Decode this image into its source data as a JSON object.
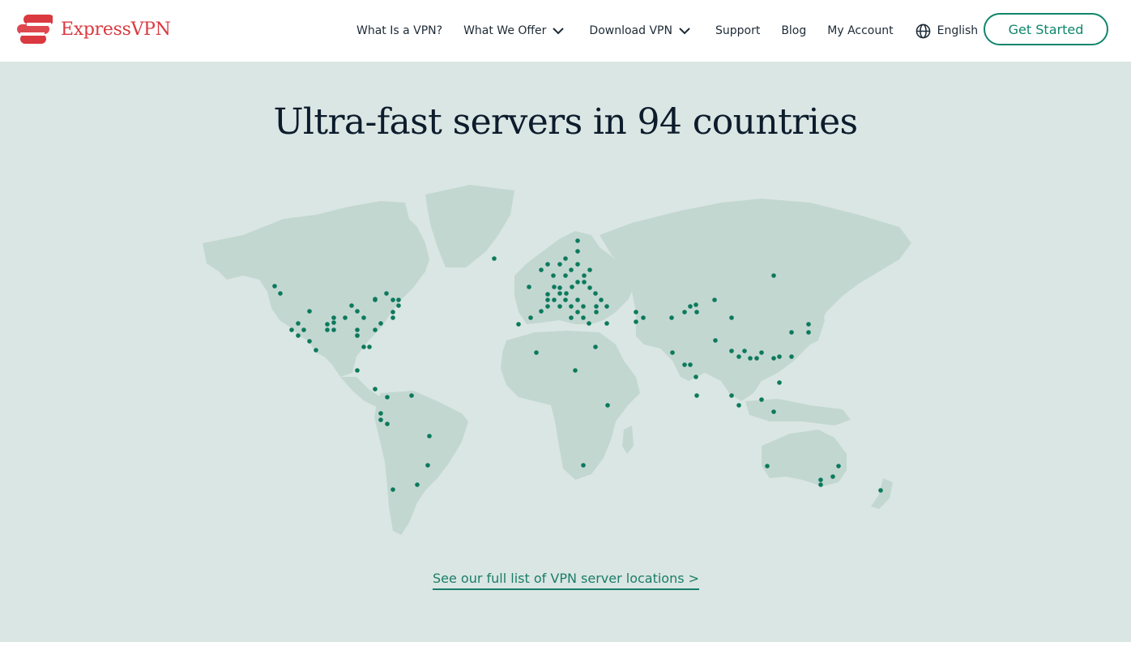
{
  "header": {
    "brand": "ExpressVPN",
    "nav": [
      {
        "label": "What Is a VPN?",
        "dropdown": false
      },
      {
        "label": "What We Offer",
        "dropdown": true
      },
      {
        "label": "Download VPN",
        "dropdown": true
      },
      {
        "label": "Support",
        "dropdown": false
      },
      {
        "label": "Blog",
        "dropdown": false
      },
      {
        "label": "My Account",
        "dropdown": false
      }
    ],
    "language": "English",
    "cta": "Get Started"
  },
  "hero": {
    "title": "Ultra-fast servers in 94 countries"
  },
  "map": {
    "land_color": "#c3d7d1",
    "dot_color": "#0c7a5c",
    "icon": "world-map-dotted"
  },
  "link": {
    "full_list": "See our full list of VPN server locations >"
  },
  "colors": {
    "brand_red": "#da3940",
    "accent_green": "#0f866c",
    "background": "#dae6e3"
  }
}
